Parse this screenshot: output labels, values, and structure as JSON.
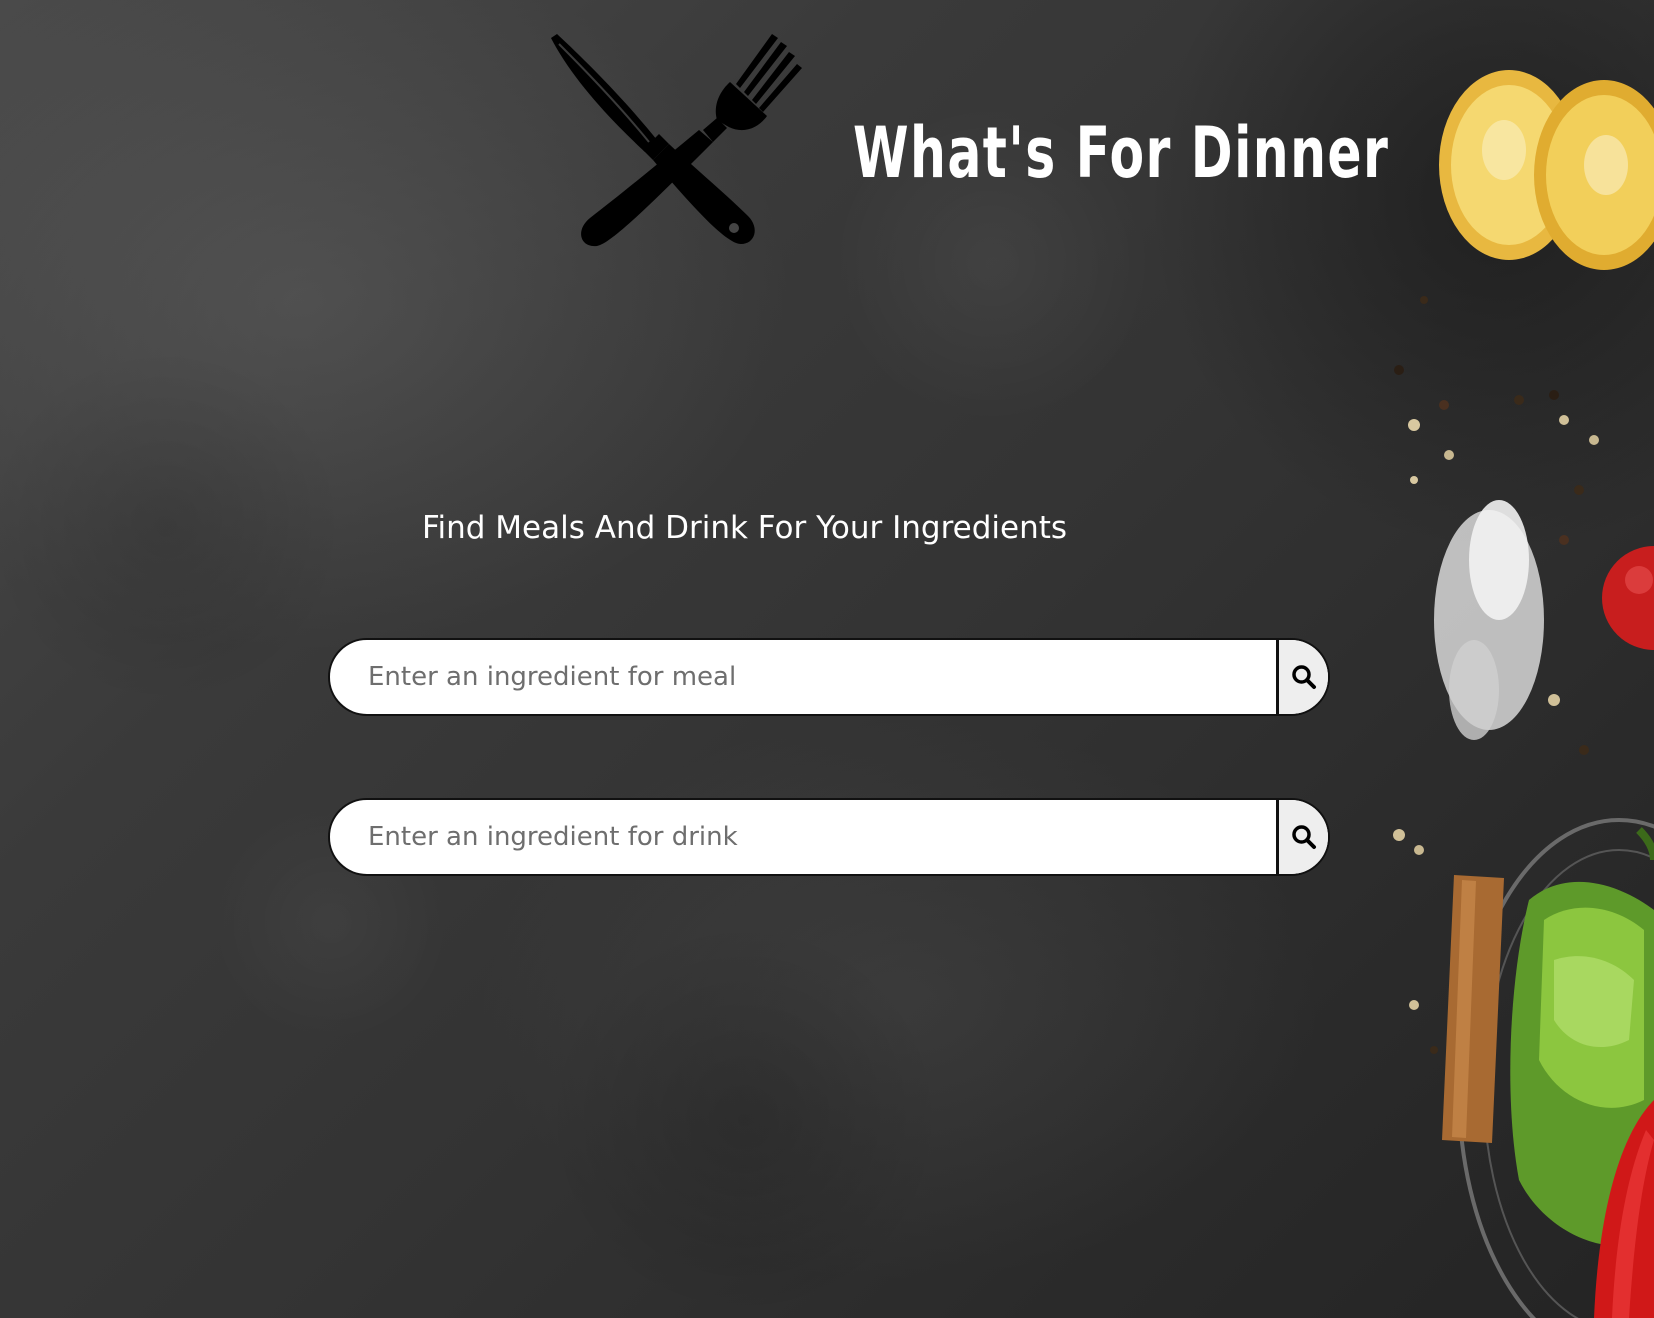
{
  "header": {
    "title": "What's For Dinner",
    "logo_icon": "knife-and-fork-icon"
  },
  "main": {
    "tagline": "Find Meals And Drink For Your Ingredients",
    "meal_search": {
      "value": "",
      "placeholder": "Enter an ingredient for meal",
      "button_icon": "search-icon"
    },
    "drink_search": {
      "value": "",
      "placeholder": "Enter an ingredient for drink",
      "button_icon": "search-icon"
    }
  },
  "colors": {
    "background": "#333333",
    "text": "#ffffff",
    "input_background": "#ffffff",
    "button_background": "#eeeeee",
    "border": "#111111"
  }
}
